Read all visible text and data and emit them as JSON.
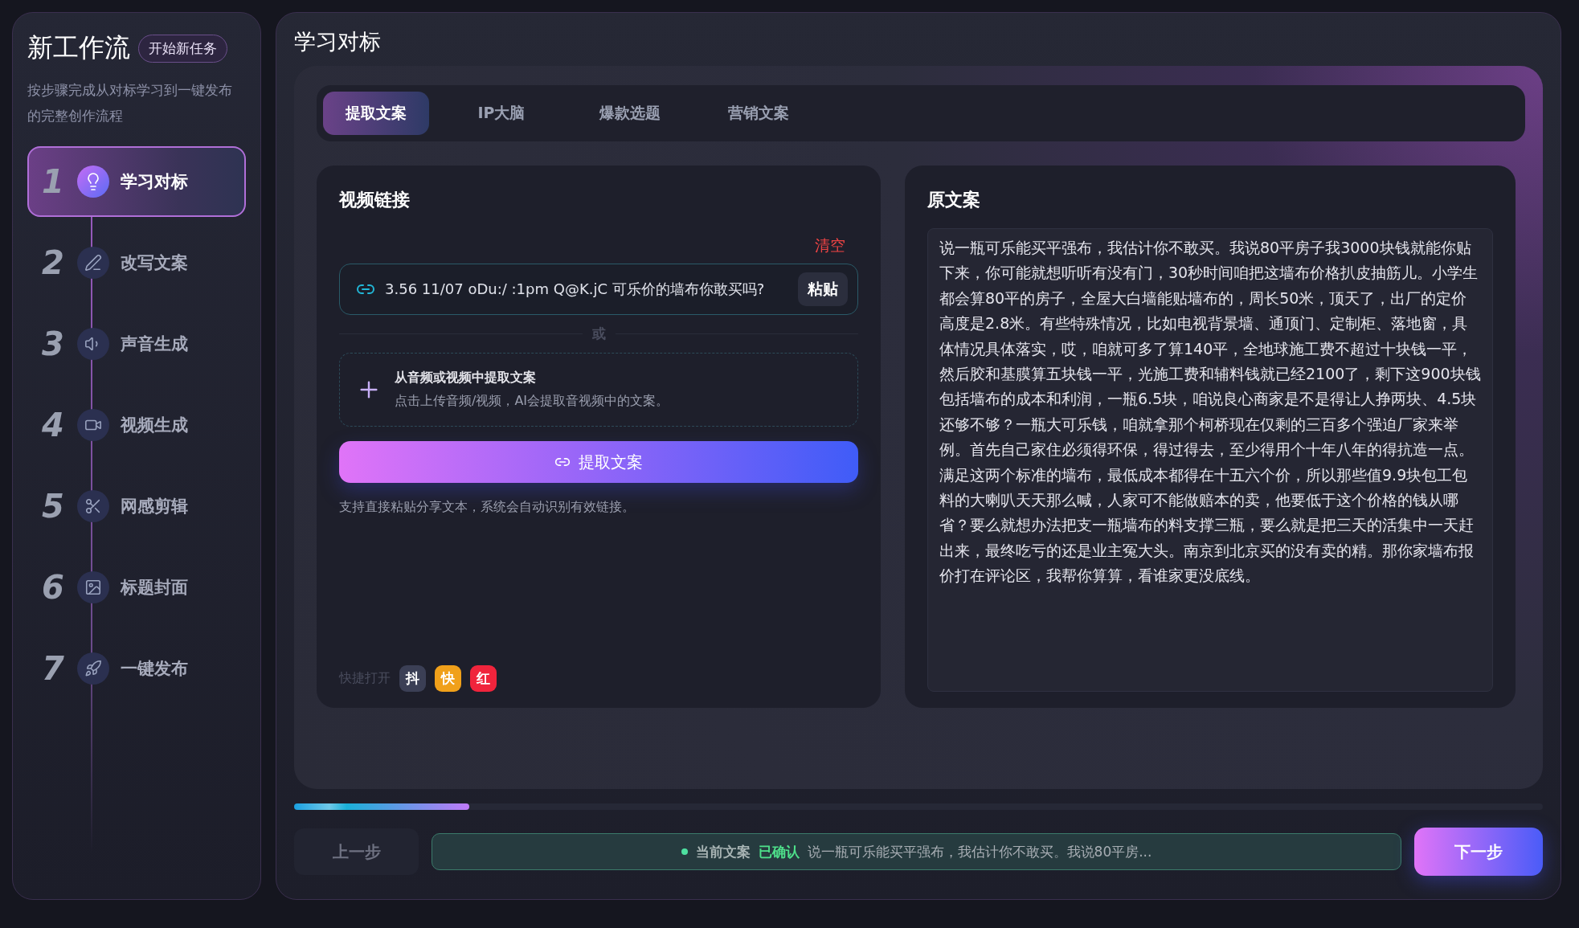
{
  "sidebar": {
    "title": "新工作流",
    "new_task_button": "开始新任务",
    "description": "按步骤完成从对标学习到一键发布的完整创作流程",
    "steps": [
      {
        "number": "1",
        "label": "学习对标",
        "selected": true
      },
      {
        "number": "2",
        "label": "改写文案",
        "selected": false
      },
      {
        "number": "3",
        "label": "声音生成",
        "selected": false
      },
      {
        "number": "4",
        "label": "视频生成",
        "selected": false
      },
      {
        "number": "5",
        "label": "网感剪辑",
        "selected": false
      },
      {
        "number": "6",
        "label": "标题封面",
        "selected": false
      },
      {
        "number": "7",
        "label": "一键发布",
        "selected": false
      }
    ]
  },
  "main": {
    "title": "学习对标",
    "tabs": [
      {
        "label": "提取文案",
        "selected": true
      },
      {
        "label": "IP大脑",
        "selected": false
      },
      {
        "label": "爆款选题",
        "selected": false
      },
      {
        "label": "营销文案",
        "selected": false
      }
    ],
    "link_panel": {
      "title": "视频链接",
      "clear_button": "清空",
      "link_value": "3.56 11/07 oDu:/ :1pm Q@K.jC 可乐价的墙布你敢买吗?",
      "paste_button": "粘贴",
      "divider_text": "或",
      "upload": {
        "title": "从音频或视频中提取文案",
        "hint": "点击上传音频/视频，AI会提取音视频中的文案。"
      },
      "extract_button": "提取文案",
      "help_text": "支持直接粘贴分享文本，系统会自动识别有效链接。",
      "quick_open": {
        "label": "快捷打开",
        "apps": [
          {
            "label": "抖",
            "color": "#3b3f55"
          },
          {
            "label": "快",
            "color": "#f0a01a"
          },
          {
            "label": "红",
            "color": "#f0243c"
          }
        ]
      }
    },
    "original_panel": {
      "title": "原文案",
      "text": "说一瓶可乐能买平强布，我估计你不敢买。我说80平房子我3000块钱就能你贴下来，你可能就想听听有没有门，30秒时间咱把这墙布价格扒皮抽筋儿。小学生都会算80平的房子，全屋大白墙能贴墙布的，周长50米，顶天了，出厂的定价高度是2.8米。有些特殊情况，比如电视背景墙、通顶门、定制柜、落地窗，具体情况具体落实，哎，咱就可多了算140平，全地球施工费不超过十块钱一平，然后胶和基膜算五块钱一平，光施工费和辅料钱就已经2100了，剩下这900块钱包括墙布的成本和利润，一瓶6.5块，咱说良心商家是不是得让人挣两块、4.5块还够不够？一瓶大可乐钱，咱就拿那个柯桥现在仅剩的三百多个强迫厂家来举例。首先自己家住必须得环保，得过得去，至少得用个十年八年的得抗造一点。满足这两个标准的墙布，最低成本都得在十五六个价，所以那些值9.9块包工包料的大喇叭天天那么喊，人家可不能做赔本的卖，他要低于这个价格的钱从哪省？要么就想办法把支一瓶墙布的料支撑三瓶，要么就是把三天的活集中一天赶出来，最终吃亏的还是业主冤大头。南京到北京买的没有卖的精。那你家墙布报价打在评论区，我帮你算算，看谁家更没底线。"
    },
    "progress": {
      "level": 0.14
    },
    "footer": {
      "prev_button": "上一步",
      "status_label": "当前文案",
      "status_badge": "已确认",
      "status_text": "说一瓶可乐能买平强布，我估计你不敢买。我说80平房...",
      "next_button": "下一步"
    }
  }
}
